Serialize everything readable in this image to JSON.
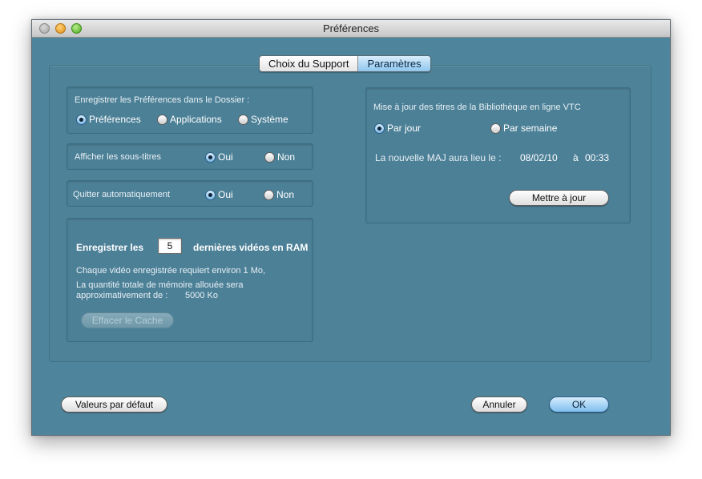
{
  "window": {
    "title": "Préférences"
  },
  "tabs": [
    {
      "label": "Choix du Support",
      "active": false
    },
    {
      "label": "Paramètres",
      "active": true
    }
  ],
  "folder_group": {
    "label": "Enregistrer les Préférences dans le Dossier :",
    "options": [
      "Préférences",
      "Applications",
      "Système"
    ],
    "selected": "Préférences"
  },
  "subtitles_group": {
    "label": "Afficher les sous-titres",
    "options": [
      "Oui",
      "Non"
    ],
    "selected": "Oui"
  },
  "quit_group": {
    "label": "Quitter automatiquement",
    "options": [
      "Oui",
      "Non"
    ],
    "selected": "Oui"
  },
  "cache_group": {
    "save_prefix": "Enregistrer les",
    "count": "5",
    "save_suffix": "dernières vidéos en RAM",
    "note1": "Chaque vidéo enregistrée requiert environ 1 Mo,",
    "note2": "La quantité totale de mémoire allouée sera",
    "note3_prefix": "approximativement de :",
    "note3_value": "5000 Ko",
    "clear_button": "Effacer le Cache"
  },
  "update_group": {
    "label": "Mise à jour des titres de la Bibliothèque en ligne VTC",
    "options": [
      "Par jour",
      "Par semaine"
    ],
    "selected": "Par jour",
    "next_label": "La nouvelle MAJ aura lieu le :",
    "next_date": "08/02/10",
    "at": "à",
    "next_time": "00:33",
    "update_button": "Mettre à jour"
  },
  "footer": {
    "defaults_button": "Valeurs par défaut",
    "cancel_button": "Annuler",
    "ok_button": "OK"
  },
  "colors": {
    "window_bg": "#4f859c",
    "accent_blue": "#8ec7ef"
  }
}
